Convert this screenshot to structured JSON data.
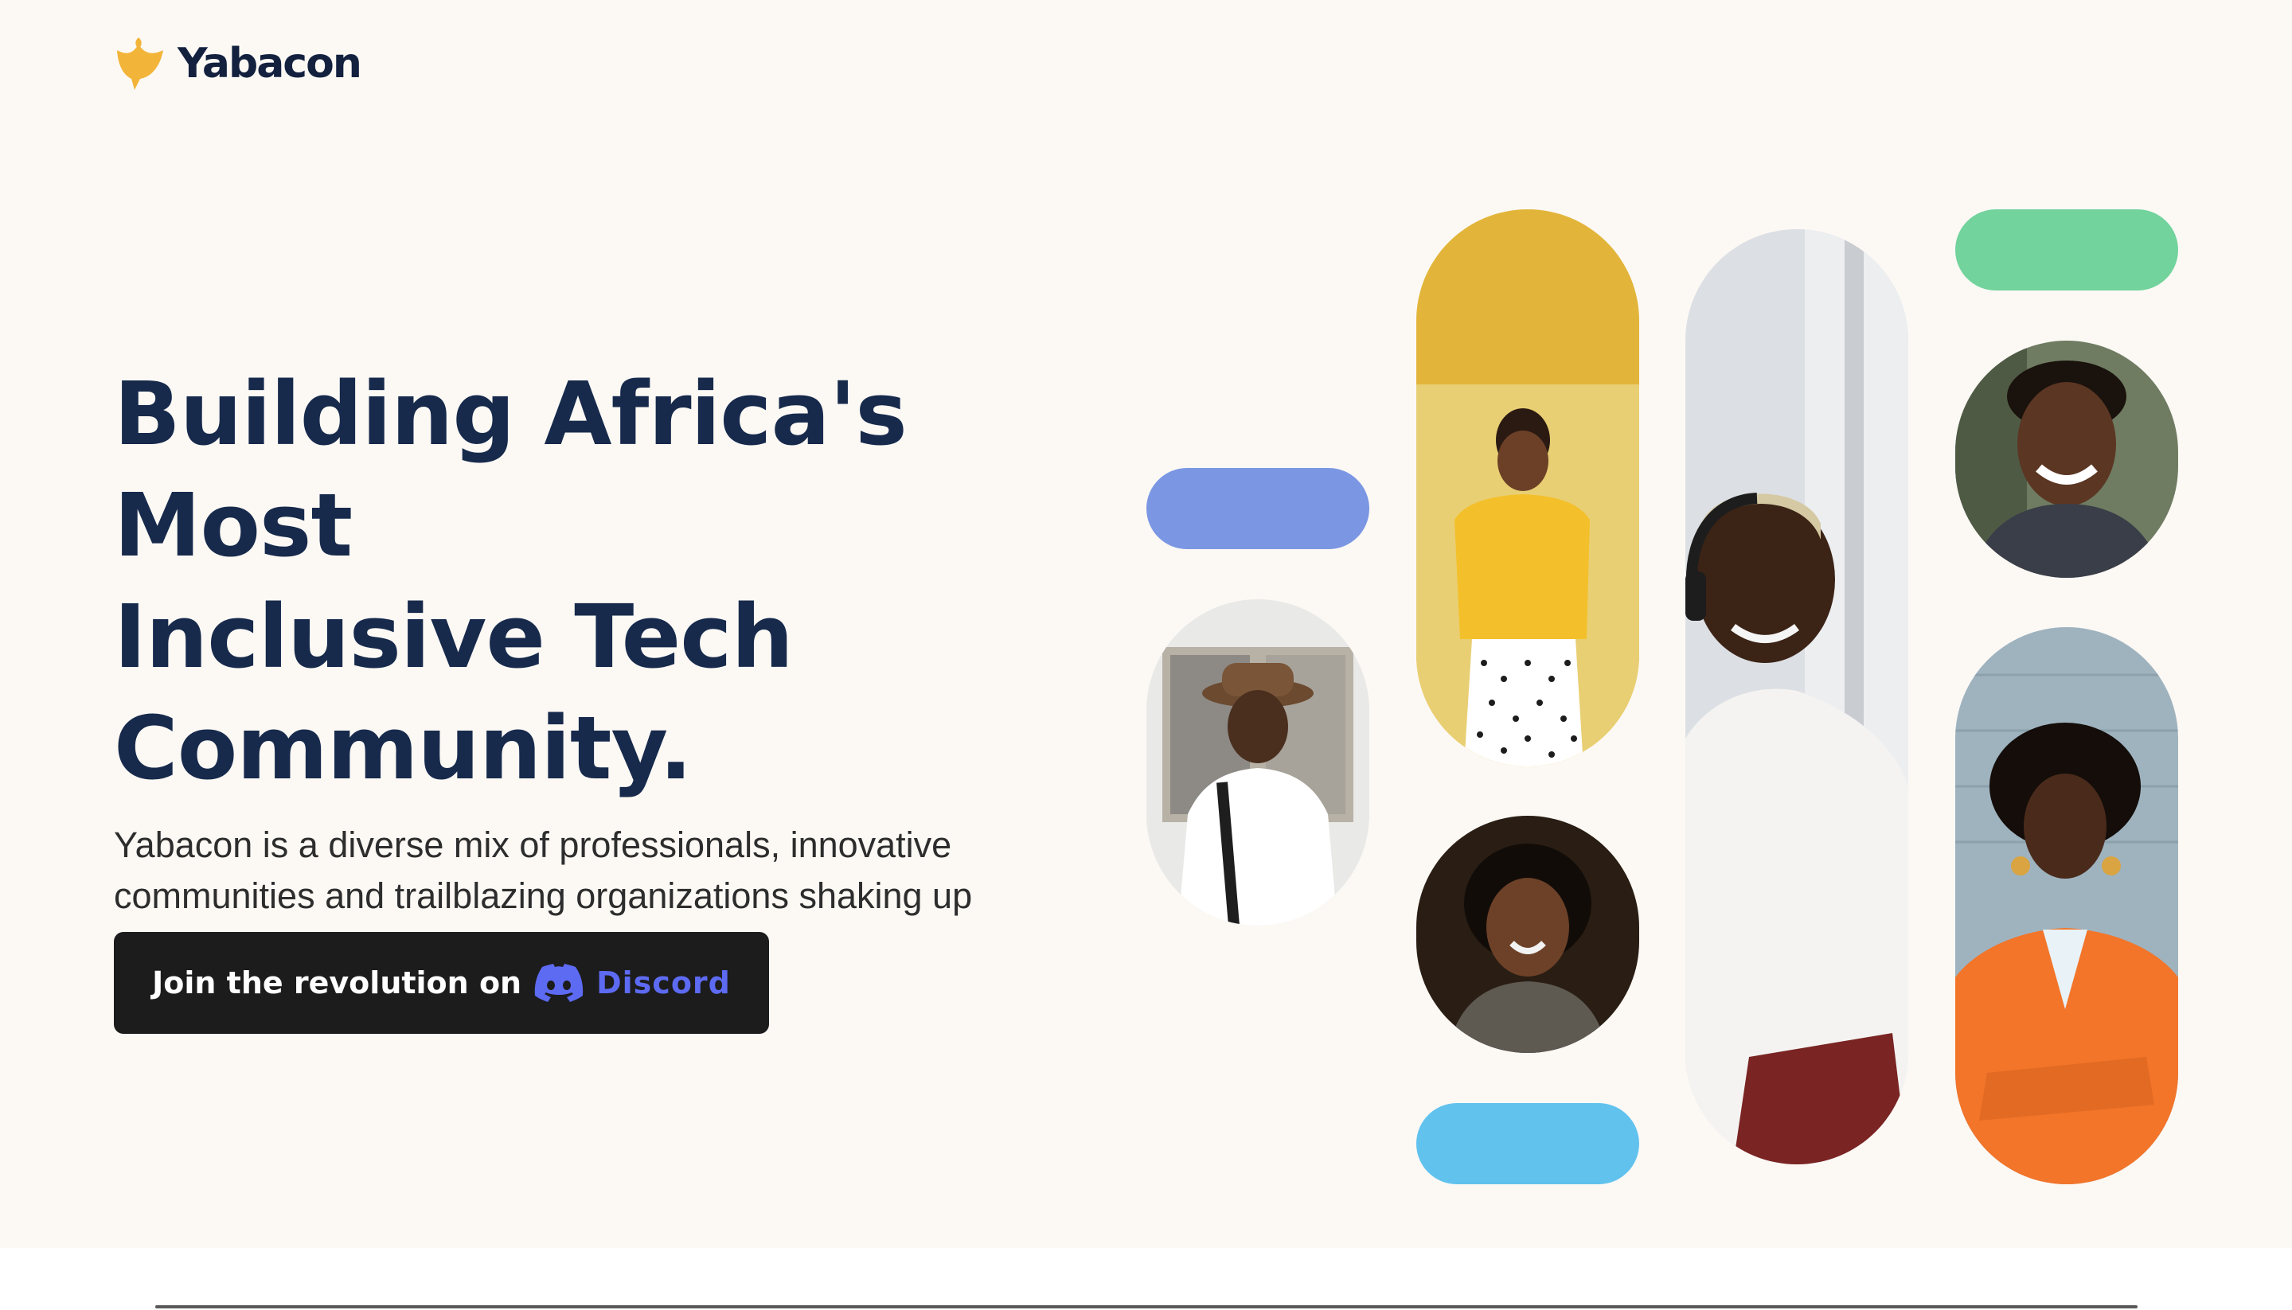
{
  "header": {
    "brand": "Yabacon",
    "logo_icon": "yabacon-flame-logo-icon"
  },
  "hero": {
    "title_lines": [
      "Building Africa's Most",
      "Inclusive Tech",
      "Community."
    ],
    "subtitle": "Yabacon is a diverse mix of professionals, innovative communities and trailblazing organizations shaking up the African technology ecosystem."
  },
  "cta": {
    "label": "Join the revolution on",
    "platform": "Discord",
    "icon": "discord-icon"
  },
  "colors": {
    "accent_yellow": "#f2b53a",
    "navy": "#172a4c",
    "pill_blue": "#7b97e3",
    "pill_green": "#72d39c",
    "pill_sky": "#62c2ee",
    "discord": "#5d6af2"
  },
  "collage": {
    "photos": [
      "man-with-hat-photo",
      "woman-yellow-wall-photo",
      "woman-smiling-dark-photo",
      "man-headphones-photo",
      "man-smiling-photo",
      "woman-orange-blazer-photo"
    ]
  }
}
